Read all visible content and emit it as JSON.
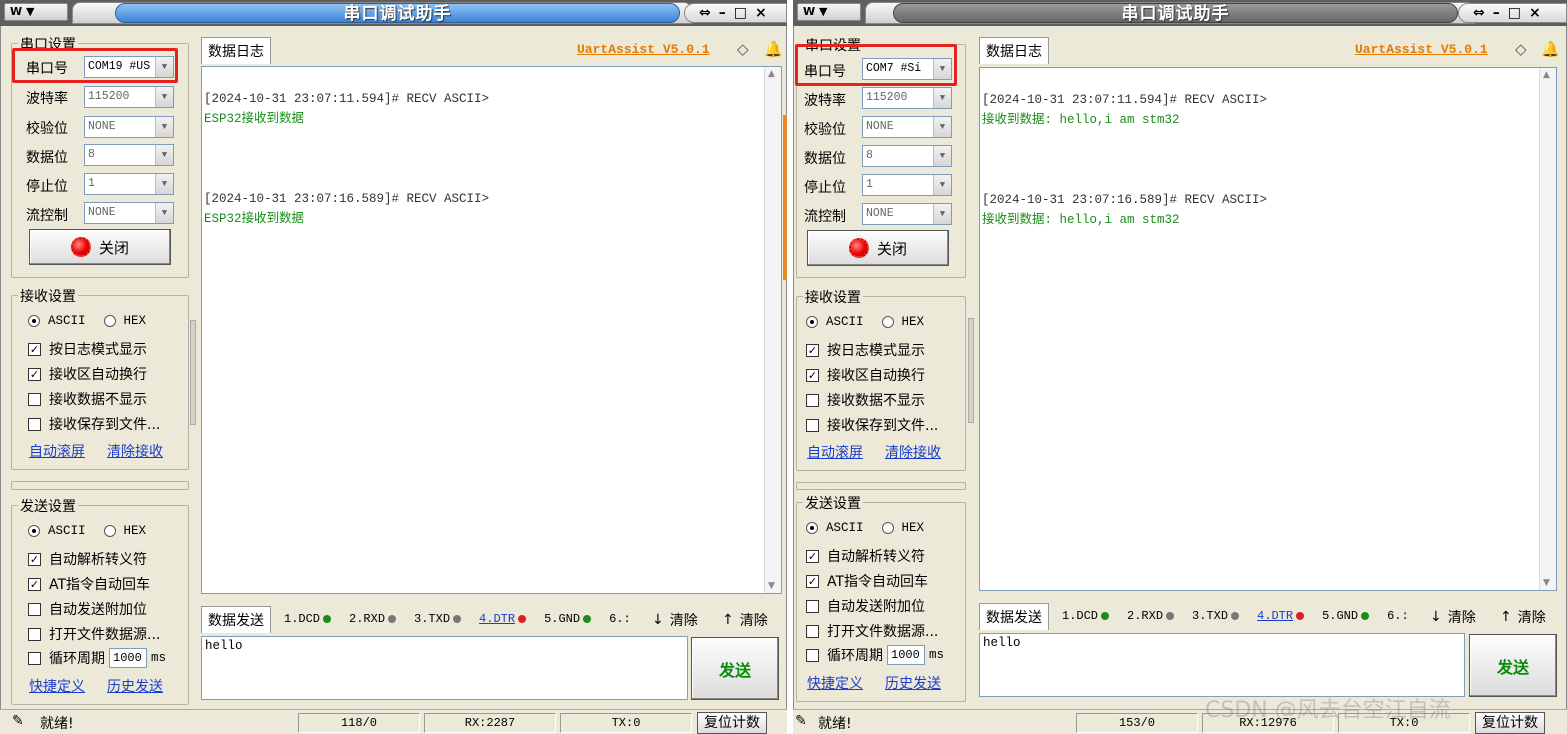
{
  "left": {
    "title": "串口调试助手",
    "title_menu": "▼",
    "title_controls": [
      "⇔",
      "–",
      "□",
      "×"
    ],
    "version": "UartAssist V5.0.1",
    "serial_settings": {
      "group_title": "串口设置",
      "port_label": "串口号",
      "port_value": "COM19 #US",
      "baud_label": "波特率",
      "baud_value": "115200",
      "parity_label": "校验位",
      "parity_value": "NONE",
      "databits_label": "数据位",
      "databits_value": "8",
      "stopbits_label": "停止位",
      "stopbits_value": "1",
      "flow_label": "流控制",
      "flow_value": "NONE",
      "close_label": "关闭"
    },
    "recv_settings": {
      "group_title": "接收设置",
      "ascii": "ASCII",
      "hex": "HEX",
      "opt1": "按日志模式显示",
      "opt2": "接收区自动换行",
      "opt3": "接收数据不显示",
      "opt4": "接收保存到文件...",
      "link1": "自动滚屏",
      "link2": "清除接收"
    },
    "send_settings": {
      "group_title": "发送设置",
      "ascii": "ASCII",
      "hex": "HEX",
      "opt1": "自动解析转义符",
      "opt2": "AT指令自动回车",
      "opt3": "自动发送附加位",
      "opt4": "打开文件数据源...",
      "opt5": "循环周期",
      "cycle_value": "1000",
      "cycle_unit": "ms",
      "link1": "快捷定义",
      "link2": "历史发送"
    },
    "log_tab": "数据日志",
    "log": [
      {
        "head": "[2024-10-31 23:07:11.594]# RECV ASCII>",
        "data": "ESP32接收到数据"
      },
      {
        "head": "[2024-10-31 23:07:16.589]# RECV ASCII>",
        "data": "ESP32接收到数据"
      }
    ],
    "send_tab": "数据发送",
    "pins": [
      {
        "label": "1.DCD",
        "color": "#1a8c1a",
        "link": false
      },
      {
        "label": "2.RXD",
        "color": "#777777",
        "link": false
      },
      {
        "label": "3.TXD",
        "color": "#777777",
        "link": false
      },
      {
        "label": "4.DTR",
        "color": "#e02020",
        "link": true
      },
      {
        "label": "5.GND",
        "color": "#1a8c1a",
        "link": false
      },
      {
        "label": "6.:",
        "color": "",
        "link": false
      }
    ],
    "clear_send": "清除",
    "clear_recv": "清除",
    "send_text": "hello",
    "send_btn": "发送",
    "status_text": "就绪!",
    "status_count": "118/0",
    "status_rx": "RX:2287",
    "status_tx": "TX:0",
    "reset_btn": "复位计数"
  },
  "right": {
    "title": "串口调试助手",
    "title_menu": "▼",
    "title_controls": [
      "⇔",
      "–",
      "□",
      "×"
    ],
    "version": "UartAssist V5.0.1",
    "serial_settings": {
      "group_title": "串口设置",
      "port_label": "串口号",
      "port_value": "COM7 #Si",
      "baud_label": "波特率",
      "baud_value": "115200",
      "parity_label": "校验位",
      "parity_value": "NONE",
      "databits_label": "数据位",
      "databits_value": "8",
      "stopbits_label": "停止位",
      "stopbits_value": "1",
      "flow_label": "流控制",
      "flow_value": "NONE",
      "close_label": "关闭"
    },
    "recv_settings": {
      "group_title": "接收设置",
      "ascii": "ASCII",
      "hex": "HEX",
      "opt1": "按日志模式显示",
      "opt2": "接收区自动换行",
      "opt3": "接收数据不显示",
      "opt4": "接收保存到文件...",
      "link1": "自动滚屏",
      "link2": "清除接收"
    },
    "send_settings": {
      "group_title": "发送设置",
      "ascii": "ASCII",
      "hex": "HEX",
      "opt1": "自动解析转义符",
      "opt2": "AT指令自动回车",
      "opt3": "自动发送附加位",
      "opt4": "打开文件数据源...",
      "opt5": "循环周期",
      "cycle_value": "1000",
      "cycle_unit": "ms",
      "link1": "快捷定义",
      "link2": "历史发送"
    },
    "log_tab": "数据日志",
    "log": [
      {
        "head": "[2024-10-31 23:07:11.594]# RECV ASCII>",
        "data": "接收到数据: hello,i am stm32"
      },
      {
        "head": "[2024-10-31 23:07:16.589]# RECV ASCII>",
        "data": "接收到数据: hello,i am stm32"
      }
    ],
    "send_tab": "数据发送",
    "pins": [
      {
        "label": "1.DCD",
        "color": "#1a8c1a",
        "link": false
      },
      {
        "label": "2.RXD",
        "color": "#777777",
        "link": false
      },
      {
        "label": "3.TXD",
        "color": "#777777",
        "link": false
      },
      {
        "label": "4.DTR",
        "color": "#e02020",
        "link": true
      },
      {
        "label": "5.GND",
        "color": "#1a8c1a",
        "link": false
      },
      {
        "label": "6.:",
        "color": "",
        "link": false
      }
    ],
    "clear_send": "清除",
    "clear_recv": "清除",
    "send_text": "hello",
    "send_btn": "发送",
    "status_text": "就绪!",
    "status_count": "153/0",
    "status_rx": "RX:12976",
    "status_tx": "TX:0",
    "reset_btn": "复位计数"
  },
  "watermark": "CSDN @风去台空江自流"
}
